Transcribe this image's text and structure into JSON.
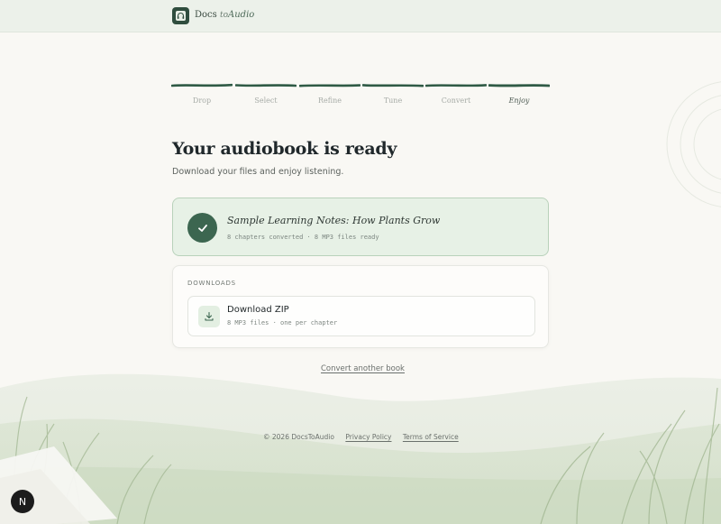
{
  "header": {
    "brand_prefix": "Docs",
    "brand_mid": "to",
    "brand_suffix": "Audio",
    "logo_icon": "headphones-book-icon"
  },
  "steps": [
    {
      "label": "Drop",
      "active": false
    },
    {
      "label": "Select",
      "active": false
    },
    {
      "label": "Refine",
      "active": false
    },
    {
      "label": "Tune",
      "active": false
    },
    {
      "label": "Convert",
      "active": false
    },
    {
      "label": "Enjoy",
      "active": true
    }
  ],
  "page": {
    "title": "Your audiobook is ready",
    "subtitle": "Download your files and enjoy listening."
  },
  "result": {
    "book_title": "Sample Learning Notes: How Plants Grow",
    "meta": "8 chapters converted · 8 MP3 files ready",
    "icon": "check-icon"
  },
  "downloads": {
    "heading": "DOWNLOADS",
    "zip_title": "Download ZIP",
    "zip_meta": "8 MP3 files · one per chapter",
    "icon": "download-icon"
  },
  "convert_another": "Convert another book",
  "footer": {
    "copyright": "© 2026 DocsToAudio",
    "privacy": "Privacy Policy",
    "terms": "Terms of Service"
  },
  "dev_badge": "N",
  "colors": {
    "accent": "#3c6650",
    "progress": "#2f5a45",
    "success_bg": "#e7f1e6",
    "header_bg": "#ecf1ea"
  }
}
